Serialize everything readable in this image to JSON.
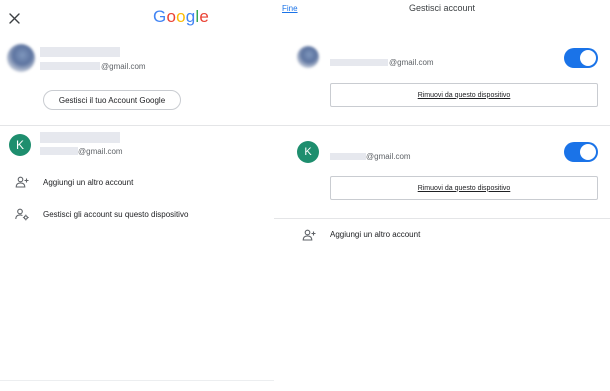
{
  "left_panel": {
    "logo": [
      {
        "ch": "G",
        "color": "#4285F4"
      },
      {
        "ch": "o",
        "color": "#EA4335"
      },
      {
        "ch": "o",
        "color": "#FBBC05"
      },
      {
        "ch": "g",
        "color": "#4285F4"
      },
      {
        "ch": "l",
        "color": "#34A853"
      },
      {
        "ch": "e",
        "color": "#EA4335"
      }
    ],
    "primary_account": {
      "email_suffix": "@gmail.com"
    },
    "manage_google_account_label": "Gestisci il tuo Account Google",
    "secondary_account": {
      "avatar_letter": "K",
      "email_suffix": "@gmail.com"
    },
    "menu": [
      {
        "label": "Aggiungi un altro account",
        "icon": "person-add-icon"
      },
      {
        "label": "Gestisci gli account su questo dispositivo",
        "icon": "manage-accounts-icon"
      }
    ]
  },
  "right_panel": {
    "done_label": "Fine",
    "title": "Gestisci account",
    "accounts": [
      {
        "email_suffix": "@gmail.com",
        "sync_enabled": true,
        "remove_label": "Rimuovi da questo dispositivo"
      },
      {
        "avatar_letter": "K",
        "email_suffix": "@gmail.com",
        "sync_enabled": true,
        "remove_label": "Rimuovi da questo dispositivo"
      }
    ],
    "add_account_label": "Aggiungi un altro account"
  },
  "colors": {
    "accent_blue": "#1a73e8",
    "avatar_green": "#1e8e6e"
  }
}
